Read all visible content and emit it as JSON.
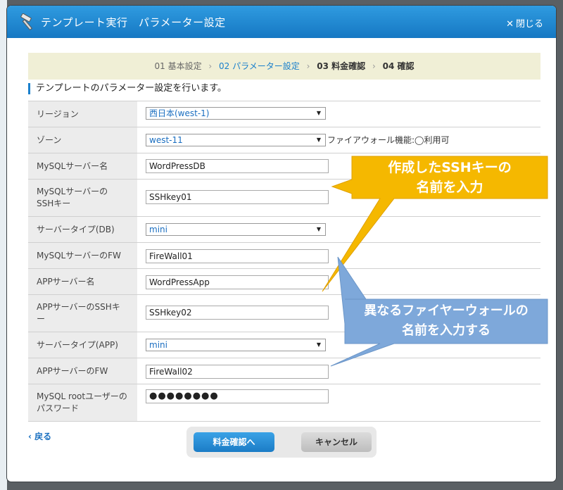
{
  "dialog": {
    "title": "テンプレート実行　パラメーター設定",
    "close_label": "閉じる"
  },
  "steps": [
    {
      "label": "01 基本設定"
    },
    {
      "label": "02 パラメーター設定"
    },
    {
      "label": "03 料金確認"
    },
    {
      "label": "04 確認"
    }
  ],
  "section_title": "テンプレートのパラメーター設定を行います。",
  "fields": {
    "region": {
      "label": "リージョン",
      "value": "西日本(west-1)"
    },
    "zone": {
      "label": "ゾーン",
      "value": "west-11",
      "note": "ファイアウォール機能:◯利用可"
    },
    "mysql_name": {
      "label": "MySQLサーバー名",
      "value": "WordPressDB"
    },
    "mysql_ssh": {
      "label": "MySQLサーバーのSSHキー",
      "value": "SSHkey01"
    },
    "db_type": {
      "label": "サーバータイプ(DB)",
      "value": "mini"
    },
    "mysql_fw": {
      "label": "MySQLサーバーのFW",
      "value": "FireWall01"
    },
    "app_name": {
      "label": "APPサーバー名",
      "value": "WordPressApp"
    },
    "app_ssh": {
      "label": "APPサーバーのSSHキー",
      "value": "SSHkey02"
    },
    "app_type": {
      "label": "サーバータイプ(APP)",
      "value": "mini"
    },
    "app_fw": {
      "label": "APPサーバーのFW",
      "value": "FireWall02"
    },
    "root_pw": {
      "label": "MySQL rootユーザーのパスワード",
      "value": "●●●●●●●●"
    }
  },
  "footer": {
    "back_label": "戻る",
    "confirm_label": "料金確認へ",
    "cancel_label": "キャンセル"
  },
  "callouts": {
    "ssh": {
      "line1": "作成したSSHキーの",
      "line2": "名前を入力",
      "color": "#f5b800"
    },
    "fw": {
      "line1": "異なるファイヤーウォールの",
      "line2": "名前を入力する",
      "color": "#7ea8da"
    }
  }
}
